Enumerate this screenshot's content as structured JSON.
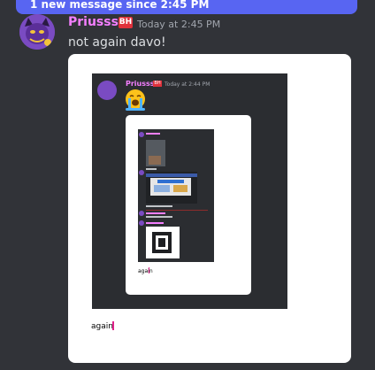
{
  "banner": {
    "text": "1 new message since 2:45 PM"
  },
  "message": {
    "author": "Priusss",
    "badge": "BH",
    "timestamp": "Today at 2:45 PM",
    "content": "not again davo!",
    "name_color": "#f47fff"
  },
  "embed": {
    "inner_author": "Priusss",
    "inner_badge": "BH",
    "inner_timestamp": "Today at 2:44 PM",
    "inner_emoji": "loudly-crying-face",
    "nested_caption": "again",
    "caption": "again"
  },
  "colors": {
    "bg": "#313338",
    "accent": "#5865f2",
    "badge": "#e0313b"
  }
}
